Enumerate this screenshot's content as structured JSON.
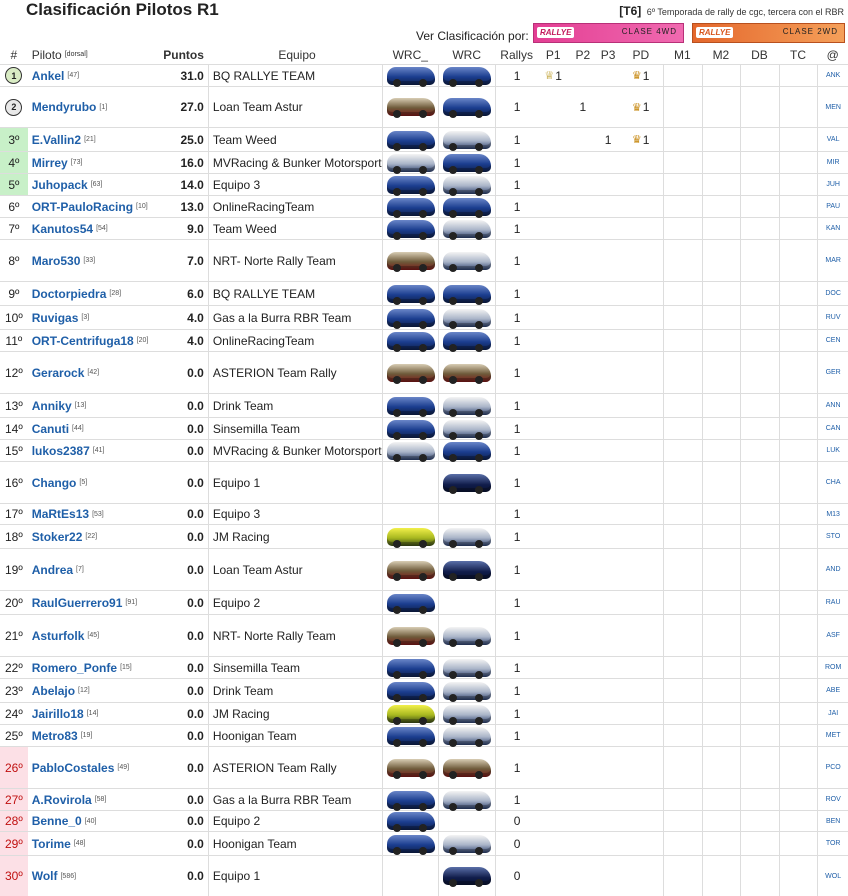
{
  "page": {
    "title": "Clasificación Pilotos R1",
    "season_tag": "[T6]",
    "season_text": "6º Temporada de rally de cgc, tercera con el RBR",
    "ver_label": "Ver Clasificación por:",
    "btn_4wd": {
      "logo": "RALLYE",
      "label": "CLASE 4WD"
    },
    "btn_2wd": {
      "logo": "RALLYE",
      "label": "CLASE 2WD"
    }
  },
  "headers": {
    "pos": "#",
    "pilot": "Piloto",
    "dorsal": "[dorsal]",
    "points": "Puntos",
    "team": "Equipo",
    "car1": "WRC_",
    "car2": "WRC",
    "rallys": "Rallys",
    "p1": "P1",
    "p2": "P2",
    "p3": "P3",
    "pd": "PD",
    "m1": "M1",
    "m2": "M2",
    "db": "DB",
    "tc": "TC",
    "abbr": "@"
  },
  "colors": {
    "pilot": "#1f5fa8",
    "green_pos": "#c8f0c8",
    "red_pos": "#fce0e6",
    "btn_4wd": "#e33e93",
    "btn_2wd": "#e4672c"
  },
  "rows": [
    {
      "pos": "1",
      "medal": "gold",
      "pilot": "Ankel",
      "dorsal": "[47]",
      "points": "31.0",
      "team": "BQ RALLYE TEAM",
      "car1": "blue",
      "car2": "blue",
      "rallys": "1",
      "p1": "1",
      "p2": "",
      "p3": "",
      "pd": "1",
      "abbr": "ANK"
    },
    {
      "pos": "2",
      "medal": "silver",
      "pilot": "Mendyrubo",
      "dorsal": "[1]",
      "points": "27.0",
      "team": "Loan Team Astur",
      "car1": "brown",
      "car2": "blue",
      "rallys": "1",
      "p1": "",
      "p2": "1",
      "p3": "",
      "pd": "1",
      "abbr": "MEN"
    },
    {
      "pos": "3º",
      "style": "green",
      "pilot": "E.Vallin2",
      "dorsal": "[21]",
      "points": "25.0",
      "team": "Team Weed",
      "car1": "blue",
      "car2": "white",
      "rallys": "1",
      "p1": "",
      "p2": "",
      "p3": "1",
      "pd": "1",
      "abbr": "VAL"
    },
    {
      "pos": "4º",
      "style": "green",
      "pilot": "Mirrey",
      "dorsal": "[73]",
      "points": "16.0",
      "team": "MVRacing & Bunker Motorsport",
      "car1": "white",
      "car2": "blue",
      "rallys": "1",
      "p1": "",
      "p2": "",
      "p3": "",
      "pd": "",
      "abbr": "MIR"
    },
    {
      "pos": "5º",
      "style": "green",
      "pilot": "Juhopack",
      "dorsal": "[63]",
      "points": "14.0",
      "team": "Equipo 3",
      "car1": "blue",
      "car2": "white",
      "rallys": "1",
      "p1": "",
      "p2": "",
      "p3": "",
      "pd": "",
      "abbr": "JUH"
    },
    {
      "pos": "6º",
      "pilot": "ORT-PauloRacing",
      "dorsal": "[10]",
      "points": "13.0",
      "team": "OnlineRacingTeam",
      "car1": "blue",
      "car2": "blue",
      "rallys": "1",
      "p1": "",
      "p2": "",
      "p3": "",
      "pd": "",
      "abbr": "PAU"
    },
    {
      "pos": "7º",
      "pilot": "Kanutos54",
      "dorsal": "[54]",
      "points": "9.0",
      "team": "Team Weed",
      "car1": "blue",
      "car2": "white",
      "rallys": "1",
      "p1": "",
      "p2": "",
      "p3": "",
      "pd": "",
      "abbr": "KAN"
    },
    {
      "pos": "8º",
      "pilot": "Maro530",
      "dorsal": "[33]",
      "points": "7.0",
      "team": "NRT- Norte Rally Team",
      "car1": "brown",
      "car2": "white",
      "rallys": "1",
      "p1": "",
      "p2": "",
      "p3": "",
      "pd": "",
      "abbr": "MAR"
    },
    {
      "pos": "9º",
      "pilot": "Doctorpiedra",
      "dorsal": "[28]",
      "points": "6.0",
      "team": "BQ RALLYE TEAM",
      "car1": "blue",
      "car2": "blue",
      "rallys": "1",
      "p1": "",
      "p2": "",
      "p3": "",
      "pd": "",
      "abbr": "DOC"
    },
    {
      "pos": "10º",
      "pilot": "Ruvigas",
      "dorsal": "[3]",
      "points": "4.0",
      "team": "Gas a la Burra RBR Team",
      "car1": "blue",
      "car2": "white",
      "rallys": "1",
      "p1": "",
      "p2": "",
      "p3": "",
      "pd": "",
      "abbr": "RUV"
    },
    {
      "pos": "11º",
      "pilot": "ORT-Centrifuga18",
      "dorsal": "[20]",
      "points": "4.0",
      "team": "OnlineRacingTeam",
      "car1": "blue",
      "car2": "blue",
      "rallys": "1",
      "p1": "",
      "p2": "",
      "p3": "",
      "pd": "",
      "abbr": "CEN"
    },
    {
      "pos": "12º",
      "pilot": "Gerarock",
      "dorsal": "[42]",
      "points": "0.0",
      "team": "ASTERION Team Rally",
      "car1": "brown",
      "car2": "brown",
      "rallys": "1",
      "p1": "",
      "p2": "",
      "p3": "",
      "pd": "",
      "abbr": "GER"
    },
    {
      "pos": "13º",
      "pilot": "Anniky",
      "dorsal": "[13]",
      "points": "0.0",
      "team": "Drink Team",
      "car1": "blue",
      "car2": "white",
      "rallys": "1",
      "p1": "",
      "p2": "",
      "p3": "",
      "pd": "",
      "abbr": "ANN"
    },
    {
      "pos": "14º",
      "pilot": "Canuti",
      "dorsal": "[44]",
      "points": "0.0",
      "team": "Sinsemilla Team",
      "car1": "blue",
      "car2": "white",
      "rallys": "1",
      "p1": "",
      "p2": "",
      "p3": "",
      "pd": "",
      "abbr": "CAN"
    },
    {
      "pos": "15º",
      "pilot": "lukos2387",
      "dorsal": "[41]",
      "points": "0.0",
      "team": "MVRacing & Bunker Motorsport",
      "car1": "white",
      "car2": "blue",
      "rallys": "1",
      "p1": "",
      "p2": "",
      "p3": "",
      "pd": "",
      "abbr": "LUK"
    },
    {
      "pos": "16º",
      "pilot": "Chango",
      "dorsal": "[5]",
      "points": "0.0",
      "team": "Equipo 1",
      "car1": "",
      "car2": "navy",
      "rallys": "1",
      "p1": "",
      "p2": "",
      "p3": "",
      "pd": "",
      "abbr": "CHA"
    },
    {
      "pos": "17º",
      "pilot": "MaRtEs13",
      "dorsal": "[53]",
      "points": "0.0",
      "team": "Equipo 3",
      "car1": "",
      "car2": "",
      "rallys": "1",
      "p1": "",
      "p2": "",
      "p3": "",
      "pd": "",
      "abbr": "M13"
    },
    {
      "pos": "18º",
      "pilot": "Stoker22",
      "dorsal": "[22]",
      "points": "0.0",
      "team": "JM Racing",
      "car1": "yellow",
      "car2": "white",
      "rallys": "1",
      "p1": "",
      "p2": "",
      "p3": "",
      "pd": "",
      "abbr": "STO"
    },
    {
      "pos": "19º",
      "pilot": "Andrea",
      "dorsal": "[7]",
      "points": "0.0",
      "team": "Loan Team Astur",
      "car1": "brown",
      "car2": "navy",
      "rallys": "1",
      "p1": "",
      "p2": "",
      "p3": "",
      "pd": "",
      "abbr": "AND"
    },
    {
      "pos": "20º",
      "pilot": "RaulGuerrero91",
      "dorsal": "[91]",
      "points": "0.0",
      "team": "Equipo 2",
      "car1": "blue",
      "car2": "",
      "rallys": "1",
      "p1": "",
      "p2": "",
      "p3": "",
      "pd": "",
      "abbr": "RAU"
    },
    {
      "pos": "21º",
      "pilot": "Asturfolk",
      "dorsal": "[45]",
      "points": "0.0",
      "team": "NRT- Norte Rally Team",
      "car1": "brown",
      "car2": "white",
      "rallys": "1",
      "p1": "",
      "p2": "",
      "p3": "",
      "pd": "",
      "abbr": "ASF"
    },
    {
      "pos": "22º",
      "pilot": "Romero_Ponfe",
      "dorsal": "[15]",
      "points": "0.0",
      "team": "Sinsemilla Team",
      "car1": "blue",
      "car2": "white",
      "rallys": "1",
      "p1": "",
      "p2": "",
      "p3": "",
      "pd": "",
      "abbr": "ROM"
    },
    {
      "pos": "23º",
      "pilot": "Abelajo",
      "dorsal": "[12]",
      "points": "0.0",
      "team": "Drink Team",
      "car1": "blue",
      "car2": "white",
      "rallys": "1",
      "p1": "",
      "p2": "",
      "p3": "",
      "pd": "",
      "abbr": "ABE"
    },
    {
      "pos": "24º",
      "pilot": "Jairillo18",
      "dorsal": "[14]",
      "points": "0.0",
      "team": "JM Racing",
      "car1": "yellow",
      "car2": "white",
      "rallys": "1",
      "p1": "",
      "p2": "",
      "p3": "",
      "pd": "",
      "abbr": "JAI"
    },
    {
      "pos": "25º",
      "pilot": "Metro83",
      "dorsal": "[19]",
      "points": "0.0",
      "team": "Hoonigan Team",
      "car1": "blue",
      "car2": "white",
      "rallys": "1",
      "p1": "",
      "p2": "",
      "p3": "",
      "pd": "",
      "abbr": "MET"
    },
    {
      "pos": "26º",
      "style": "red",
      "pilot": "PabloCostales",
      "dorsal": "[49]",
      "points": "0.0",
      "team": "ASTERION Team Rally",
      "car1": "brown",
      "car2": "brown",
      "rallys": "1",
      "p1": "",
      "p2": "",
      "p3": "",
      "pd": "",
      "abbr": "PCO"
    },
    {
      "pos": "27º",
      "style": "red",
      "pilot": "A.Rovirola",
      "dorsal": "[58]",
      "points": "0.0",
      "team": "Gas a la Burra RBR Team",
      "car1": "blue",
      "car2": "white",
      "rallys": "1",
      "p1": "",
      "p2": "",
      "p3": "",
      "pd": "",
      "abbr": "ROV"
    },
    {
      "pos": "28º",
      "style": "red",
      "pilot": "Benne_0",
      "dorsal": "[40]",
      "points": "0.0",
      "team": "Equipo 2",
      "car1": "blue",
      "car2": "",
      "rallys": "0",
      "p1": "",
      "p2": "",
      "p3": "",
      "pd": "",
      "abbr": "BEN"
    },
    {
      "pos": "29º",
      "style": "red",
      "pilot": "Torime",
      "dorsal": "[48]",
      "points": "0.0",
      "team": "Hoonigan Team",
      "car1": "blue",
      "car2": "white",
      "rallys": "0",
      "p1": "",
      "p2": "",
      "p3": "",
      "pd": "",
      "abbr": "TOR"
    },
    {
      "pos": "30º",
      "style": "red",
      "pilot": "Wolf",
      "dorsal": "[586]",
      "points": "0.0",
      "team": "Equipo 1",
      "car1": "",
      "car2": "navy",
      "rallys": "0",
      "p1": "",
      "p2": "",
      "p3": "",
      "pd": "",
      "abbr": "WOL"
    }
  ]
}
